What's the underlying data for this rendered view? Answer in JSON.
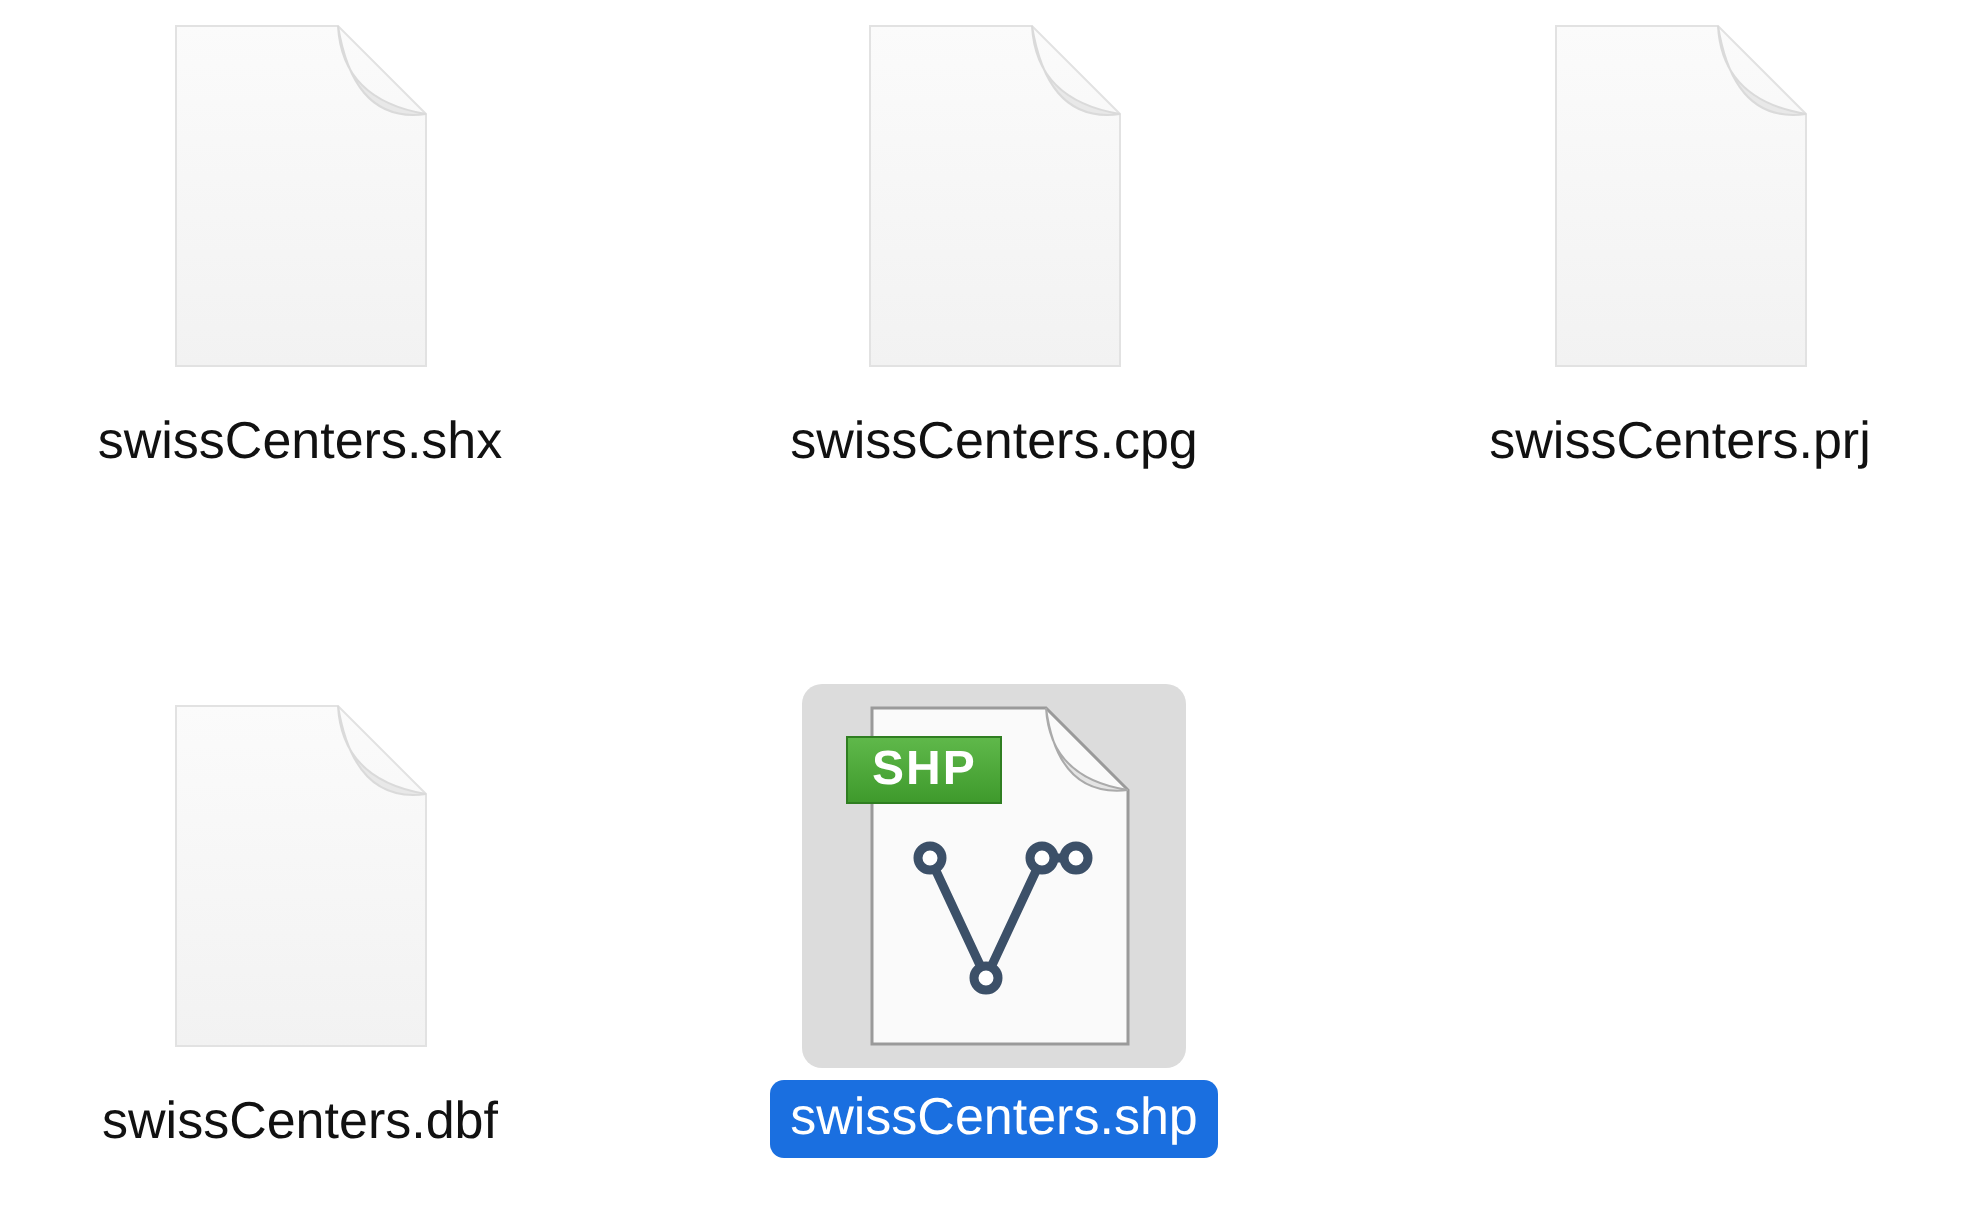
{
  "files": [
    {
      "name": "swissCenters.shx",
      "kind": "blank",
      "selected": false
    },
    {
      "name": "swissCenters.cpg",
      "kind": "blank",
      "selected": false
    },
    {
      "name": "swissCenters.prj",
      "kind": "blank",
      "selected": false
    },
    {
      "name": "swissCenters.dbf",
      "kind": "blank",
      "selected": false
    },
    {
      "name": "swissCenters.shp",
      "kind": "shp",
      "badge": "SHP",
      "selected": true
    }
  ]
}
